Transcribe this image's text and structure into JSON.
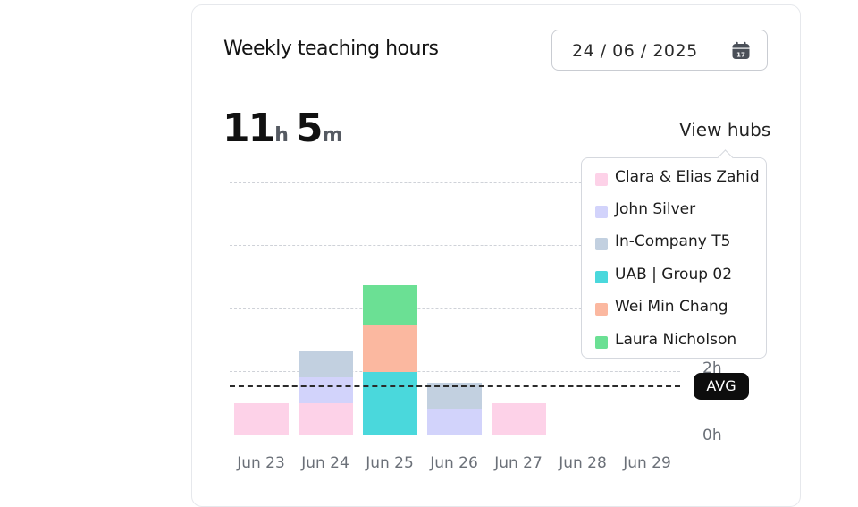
{
  "card": {
    "title": "Weekly teaching hours",
    "date_value": "24 / 06 / 2025",
    "total": {
      "hours": "11",
      "hours_unit": "h",
      "minutes": "5",
      "minutes_unit": "m"
    },
    "view_hubs_label": "View hubs",
    "avg_label": "AVG"
  },
  "icons": {
    "calendar": "calendar-icon"
  },
  "colors": {
    "clara": "#fdd2e8",
    "john": "#d2d3fb",
    "incompany": "#c2d0e0",
    "uab": "#4ad8dc",
    "weimin": "#fbb8a0",
    "laura": "#6be094"
  },
  "legend": [
    {
      "label": "Clara & Elias Zahid",
      "color": "#fdd2e8"
    },
    {
      "label": "John Silver",
      "color": "#d2d3fb"
    },
    {
      "label": "In-Company T5",
      "color": "#c2d0e0"
    },
    {
      "label": "UAB | Group 02",
      "color": "#4ad8dc"
    },
    {
      "label": "Wei Min Chang",
      "color": "#fbb8a0"
    },
    {
      "label": "Laura Nicholson",
      "color": "#6be094"
    }
  ],
  "chart_data": {
    "type": "bar",
    "stacked": true,
    "categories": [
      "Jun 23",
      "Jun 24",
      "Jun 25",
      "Jun 26",
      "Jun 27",
      "Jun 28",
      "Jun 29"
    ],
    "y_tick_labels": [
      "0h",
      "2h"
    ],
    "ylim": [
      0,
      8
    ],
    "avg": 1.57,
    "series": [
      {
        "name": "Clara & Elias Zahid",
        "color": "#fdd2e8",
        "values": [
          1.0,
          1.0,
          0,
          0,
          1.0,
          0,
          0
        ]
      },
      {
        "name": "John Silver",
        "color": "#d2d3fb",
        "values": [
          0,
          0.83,
          0,
          0.83,
          0,
          0,
          0
        ]
      },
      {
        "name": "In-Company T5",
        "color": "#c2d0e0",
        "values": [
          0,
          0.83,
          0,
          0.83,
          0,
          0,
          0
        ]
      },
      {
        "name": "UAB | Group 02",
        "color": "#4ad8dc",
        "values": [
          0,
          0,
          2.0,
          0,
          0,
          0,
          0
        ]
      },
      {
        "name": "Wei Min Chang",
        "color": "#fbb8a0",
        "values": [
          0,
          0,
          1.5,
          0,
          0,
          0,
          0
        ]
      },
      {
        "name": "Laura Nicholson",
        "color": "#6be094",
        "values": [
          0,
          0,
          1.25,
          0,
          0,
          0,
          0
        ]
      }
    ],
    "grid": true
  }
}
